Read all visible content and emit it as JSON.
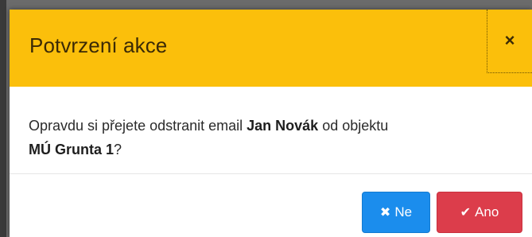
{
  "dialog": {
    "title": "Potvrzení akce",
    "close_icon": "close-icon",
    "body": {
      "text_prefix": "Opravdu si přejete odstranit email ",
      "email_name": "Jan Novák",
      "text_middle": " od objektu",
      "object_name": "MÚ Grunta 1",
      "text_suffix": "?"
    },
    "buttons": {
      "no_label": "Ne",
      "no_icon": "times-icon",
      "yes_label": "Ano",
      "yes_icon": "check-icon"
    }
  },
  "colors": {
    "header_bg": "#fbbf0b",
    "no_button": "#1b8ded",
    "yes_button": "#dc3d4b"
  }
}
